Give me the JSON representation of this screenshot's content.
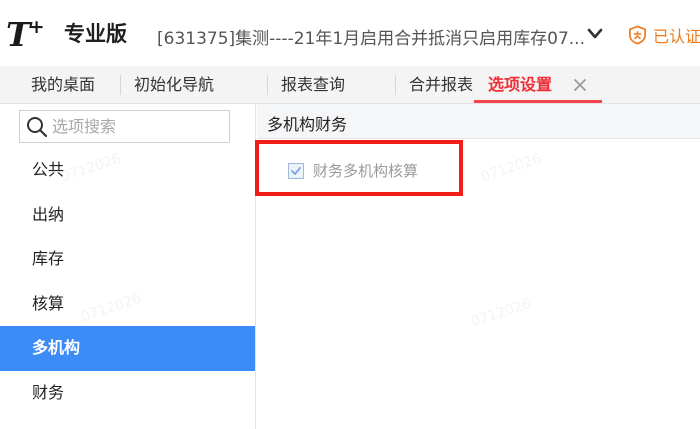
{
  "header": {
    "logo_letter": "T",
    "logo_plus": "+",
    "edition": "专业版",
    "account_name": "[631375]集测----21年1月启用合并抵消只启用库存07...",
    "certified_label": "已认证"
  },
  "tabs": [
    {
      "label": "我的桌面"
    },
    {
      "label": "初始化导航"
    },
    {
      "label": "报表查询"
    },
    {
      "label": "合并报表"
    },
    {
      "label": "选项设置",
      "active": true
    }
  ],
  "sidebar": {
    "search_placeholder": "选项搜索",
    "items": [
      {
        "label": "公共"
      },
      {
        "label": "出纳"
      },
      {
        "label": "库存"
      },
      {
        "label": "核算"
      },
      {
        "label": "多机构",
        "selected": true
      },
      {
        "label": "财务"
      }
    ]
  },
  "main": {
    "section_title": "多机构财务",
    "options": [
      {
        "label": "财务多机构核算",
        "checked": true,
        "disabled": true
      }
    ]
  },
  "colors": {
    "active_tab": "#f02f39",
    "selected_nav": "#3d8bf7",
    "highlight_box": "#f01e17",
    "certified": "#ee7a1b"
  }
}
